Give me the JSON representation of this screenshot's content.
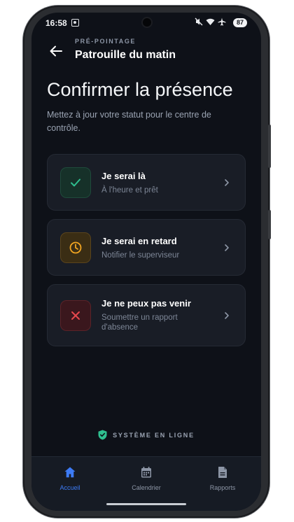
{
  "status_bar": {
    "time": "16:58",
    "battery": "87",
    "icons": [
      "screenshot-icon",
      "mute-icon",
      "wifi-icon",
      "airplane-icon"
    ]
  },
  "header": {
    "overline": "PRÉ-POINTAGE",
    "title": "Patrouille du matin"
  },
  "main": {
    "heading": "Confirmer la présence",
    "subtitle": "Mettez à jour votre statut pour le centre de contrôle.",
    "options": [
      {
        "title": "Je serai là",
        "description": "À l'heure et prêt",
        "icon": "check-icon",
        "accent": "#2fbf8f"
      },
      {
        "title": "Je serai en retard",
        "description": "Notifier le superviseur",
        "icon": "clock-icon",
        "accent": "#f0a421"
      },
      {
        "title": "Je ne peux pas venir",
        "description": "Soumettre un rapport d'absence",
        "icon": "close-icon",
        "accent": "#e5484d"
      }
    ]
  },
  "system_status": {
    "label": "SYSTÈME EN LIGNE",
    "color": "#2fbf8f"
  },
  "bottom_nav": {
    "active_color": "#3d7bf5",
    "items": [
      {
        "label": "Accueil",
        "icon": "home-icon",
        "active": true
      },
      {
        "label": "Calendrier",
        "icon": "calendar-icon",
        "active": false
      },
      {
        "label": "Rapports",
        "icon": "document-icon",
        "active": false
      }
    ]
  }
}
